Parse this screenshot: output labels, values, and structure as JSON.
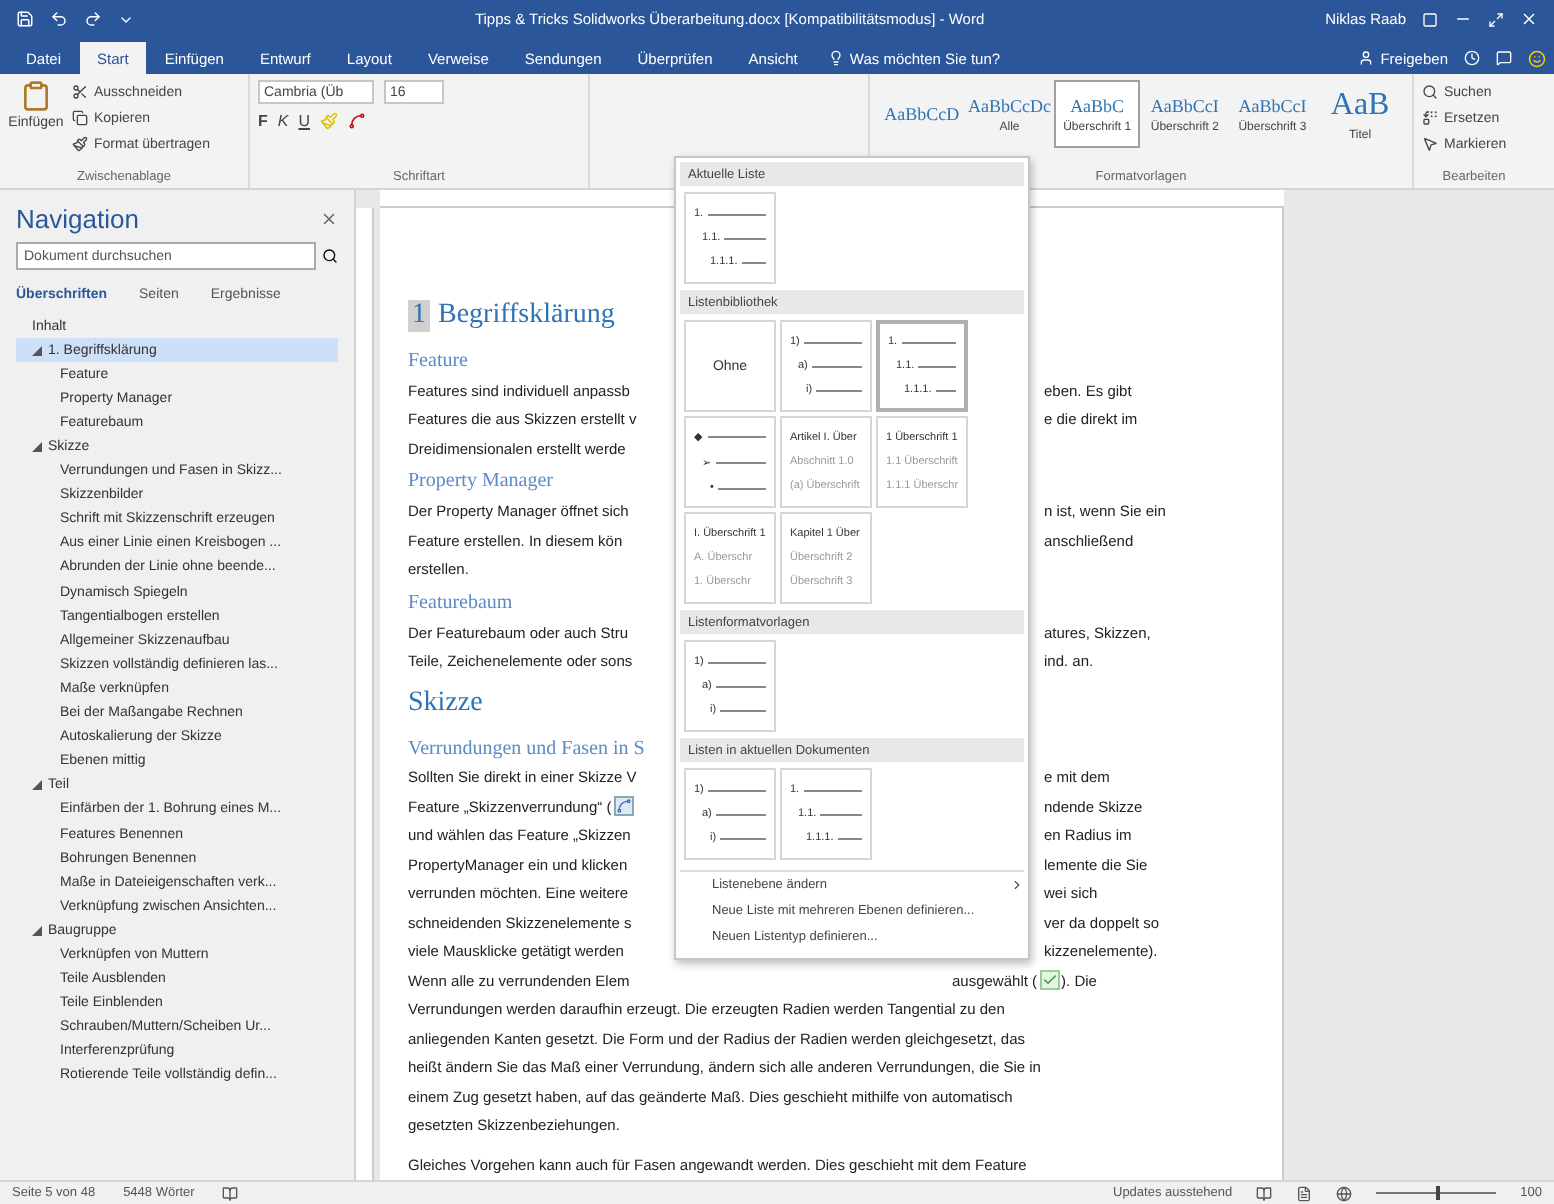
{
  "window": {
    "title": "Tipps & Tricks Solidworks Überarbeitung.docx [Kompatibilitätsmodus] - Word",
    "user": "Niklas Raab"
  },
  "ribbon_tabs": [
    {
      "label": "Datei",
      "selected": false
    },
    {
      "label": "Start",
      "selected": true
    },
    {
      "label": "Einfügen",
      "selected": false
    },
    {
      "label": "Entwurf",
      "selected": false
    },
    {
      "label": "Layout",
      "selected": false
    },
    {
      "label": "Verweise",
      "selected": false
    },
    {
      "label": "Sendungen",
      "selected": false
    },
    {
      "label": "Überprüfen",
      "selected": false
    },
    {
      "label": "Ansicht",
      "selected": false
    }
  ],
  "tell_me": "Was möchten Sie tun?",
  "share": "Freigeben",
  "clipboard": {
    "paste": "Einfügen",
    "cut": "Ausschneiden",
    "copy": "Kopieren",
    "format_painter": "Format übertragen",
    "label": "Zwischenablage"
  },
  "font": {
    "name": "Cambria (Üb",
    "size": "16",
    "label": "Schriftart",
    "format_buttons": [
      {
        "kind": "bold",
        "label": "F"
      },
      {
        "kind": "italic",
        "label": "K"
      },
      {
        "kind": "underline",
        "label": "U"
      }
    ]
  },
  "styles": {
    "items": [
      {
        "sample": "AaBbCcD",
        "selected": false
      },
      {
        "sample": "AaBbCcDc",
        "name": "Alle",
        "selected": false
      },
      {
        "sample": "AaBbC",
        "name": "Überschrift 1",
        "selected": true
      },
      {
        "sample": "AaBbCcI",
        "name": "Überschrift 2",
        "selected": false
      },
      {
        "sample": "AaBbCcI",
        "name": "Überschrift 3",
        "selected": false
      },
      {
        "sample": "AaB",
        "name": "Titel",
        "selected": false
      }
    ],
    "label": "Formatvorlagen"
  },
  "editing": {
    "items": [
      "Suchen",
      "Ersetzen",
      "Markieren"
    ],
    "label": "Bearbeiten"
  },
  "navigation": {
    "title": "Navigation",
    "search": {
      "placeholder": "Dokument durchsuchen"
    },
    "tabs": [
      {
        "label": "Überschriften",
        "selected": true
      },
      {
        "label": "Seiten",
        "selected": false
      },
      {
        "label": "Ergebnisse",
        "selected": false
      }
    ],
    "tree": [
      {
        "label": "Inhalt",
        "selected": false
      },
      {
        "label": "1. Begriffsklärung",
        "selected": true,
        "expanded": true,
        "children": [
          {
            "label": "Feature",
            "selected": false
          },
          {
            "label": "Property Manager",
            "selected": false
          },
          {
            "label": "Featurebaum",
            "selected": false
          }
        ]
      },
      {
        "label": "Skizze",
        "selected": false,
        "expanded": true,
        "children": [
          {
            "label": "Verrundungen und Fasen in Skizz...",
            "selected": false
          },
          {
            "label": "Skizzenbilder",
            "selected": false
          },
          {
            "label": "Schrift mit Skizzenschrift erzeugen",
            "selected": false
          },
          {
            "label": "Aus einer Linie einen Kreisbogen ...",
            "selected": false
          },
          {
            "label": "Abrunden der Linie ohne beende...",
            "selected": false
          },
          {
            "label": "Dynamisch Spiegeln",
            "selected": false
          },
          {
            "label": "Tangentialbogen erstellen",
            "selected": false
          },
          {
            "label": "Allgemeiner Skizzenaufbau",
            "selected": false
          },
          {
            "label": "Skizzen vollständig definieren las...",
            "selected": false
          },
          {
            "label": "Maße verknüpfen",
            "selected": false
          },
          {
            "label": "Bei der Maßangabe Rechnen",
            "selected": false
          },
          {
            "label": "Autoskalierung der Skizze",
            "selected": false
          },
          {
            "label": "Ebenen mittig",
            "selected": false
          }
        ]
      },
      {
        "label": "Teil",
        "selected": false,
        "expanded": true,
        "children": [
          {
            "label": "Einfärben der 1. Bohrung eines M...",
            "selected": false
          },
          {
            "label": "Features Benennen",
            "selected": false
          },
          {
            "label": "Bohrungen Benennen",
            "selected": false
          },
          {
            "label": "Maße in Dateieigenschaften verk...",
            "selected": false
          },
          {
            "label": "Verknüpfung zwischen Ansichten...",
            "selected": false
          }
        ]
      },
      {
        "label": "Baugruppe",
        "selected": false,
        "expanded": true,
        "children": [
          {
            "label": "Verknüpfen von Muttern",
            "selected": false
          },
          {
            "label": "Teile Ausblenden",
            "selected": false
          },
          {
            "label": "Teile Einblenden",
            "selected": false
          },
          {
            "label": "Schrauben/Muttern/Scheiben Ur...",
            "selected": false
          },
          {
            "label": "Interferenzprüfung",
            "selected": false
          },
          {
            "label": "Rotierende Teile vollständig defin...",
            "selected": false
          }
        ]
      }
    ]
  },
  "document": [
    {
      "kind": "h1",
      "num": "1",
      "text": "Begriffsklärung"
    },
    {
      "kind": "h2",
      "text": "Feature"
    },
    {
      "kind": "p",
      "left": "Features sind individuell anpassb",
      "right": "eben. Es gibt"
    },
    {
      "kind": "p",
      "left": "Features die aus Skizzen erstellt v",
      "right": "e die direkt im"
    },
    {
      "kind": "p",
      "left": "Dreidimensionalen erstellt werde"
    },
    {
      "kind": "h2",
      "text": "Property Manager"
    },
    {
      "kind": "p",
      "left": "Der Property Manager öffnet sich",
      "right": "n ist, wenn Sie ein"
    },
    {
      "kind": "p",
      "left": "Feature erstellen. In diesem kön",
      "right": "anschließend"
    },
    {
      "kind": "p",
      "left": "erstellen."
    },
    {
      "kind": "h2",
      "text": "Featurebaum"
    },
    {
      "kind": "p",
      "left": "Der Featurebaum oder auch Stru",
      "right": "atures, Skizzen,"
    },
    {
      "kind": "p",
      "left": "Teile, Zeichenelemente oder sons",
      "right": "ind. an."
    },
    {
      "kind": "h1",
      "text": "Skizze"
    },
    {
      "kind": "h2",
      "left": "Verrundungen und Fasen in S"
    },
    {
      "kind": "p",
      "left": "Sollten Sie direkt in einer Skizze V",
      "right": "e mit dem"
    },
    {
      "kind": "p-icon",
      "left": "Feature „Skizzenverrundung“ (",
      "right": "ndende Skizze"
    },
    {
      "kind": "p",
      "left": "und wählen das Feature „Skizzen",
      "right": "en Radius im"
    },
    {
      "kind": "p",
      "left": "PropertyManager ein und klicken",
      "right": "lemente die Sie"
    },
    {
      "kind": "p",
      "left": "verrunden möchten. Eine weitere",
      "right": "wei sich"
    },
    {
      "kind": "p",
      "left": "schneidenden Skizzenelemente s",
      "right": "ver da doppelt so"
    },
    {
      "kind": "p",
      "left": "viele Mausklicke getätigt werden",
      "right": "kizzenelemente)."
    },
    {
      "kind": "p-check",
      "left": "Wenn alle zu verrundenden Elem",
      "right": "ausgewählt (",
      "after": "). Die"
    },
    {
      "kind": "p",
      "left": "Verrundungen werden daraufhin erzeugt. Die erzeugten Radien werden Tangential zu den"
    },
    {
      "kind": "p",
      "left": "anliegenden Kanten gesetzt. Die Form und der Radius der Radien werden gleichgesetzt, das"
    },
    {
      "kind": "p",
      "left": "heißt ändern Sie das Maß einer Verrundung, ändern sich alle anderen Verrundungen, die Sie in"
    },
    {
      "kind": "p",
      "left": "einem Zug gesetzt haben, auf das geänderte Maß. Dies geschieht mithilfe von automatisch"
    },
    {
      "kind": "p",
      "left": "gesetzten Skizzenbeziehungen."
    },
    {
      "kind": "gap"
    },
    {
      "kind": "p",
      "left": "Gleiches Vorgehen kann auch für Fasen angewandt werden. Dies geschieht mit dem Feature"
    }
  ],
  "list_menu": {
    "sections": [
      {
        "title": "Aktuelle Liste",
        "tiles": [
          {
            "kind": "levels",
            "selected": false,
            "rows": [
              "1.",
              "1.1.",
              "1.1.1."
            ]
          }
        ]
      },
      {
        "title": "Listenbibliothek",
        "tiles": [
          {
            "kind": "none",
            "label": "Ohne",
            "selected": false
          },
          {
            "kind": "levels",
            "selected": false,
            "rows": [
              "1)",
              "a)",
              "i)"
            ]
          },
          {
            "kind": "levels",
            "selected": true,
            "rows": [
              "1.",
              "1.1.",
              "1.1.1."
            ]
          },
          {
            "kind": "levels",
            "selected": false,
            "rows": [
              "◆",
              "➢",
              "•"
            ]
          },
          {
            "kind": "headings",
            "selected": false,
            "rows": [
              "Artikel I. Über",
              "Abschnitt 1.0",
              "(a) Überschrift"
            ]
          },
          {
            "kind": "headings",
            "selected": false,
            "rows": [
              "1 Überschrift 1",
              "1.1 Überschrift",
              "1.1.1 Überschr"
            ]
          },
          {
            "kind": "headings",
            "selected": false,
            "rows": [
              "I. Überschrift 1",
              "A. Überschr",
              "1. Überschr"
            ]
          },
          {
            "kind": "headings",
            "selected": false,
            "rows": [
              "Kapitel 1 Über",
              "Überschrift 2",
              "Überschrift 3"
            ]
          }
        ]
      },
      {
        "title": "Listenformatvorlagen",
        "tiles": [
          {
            "kind": "levels",
            "selected": false,
            "rows": [
              "1)",
              "a)",
              "i)"
            ]
          }
        ]
      },
      {
        "title": "Listen in aktuellen Dokumenten",
        "tiles": [
          {
            "kind": "levels",
            "selected": false,
            "rows": [
              "1)",
              "a)",
              "i)"
            ]
          },
          {
            "kind": "levels",
            "selected": false,
            "rows": [
              "1.",
              "1.1.",
              "1.1.1."
            ]
          }
        ]
      }
    ],
    "commands": [
      {
        "label": "Listenebene ändern",
        "submenu": true
      },
      {
        "label": "Neue Liste mit mehreren Ebenen definieren...",
        "submenu": false
      },
      {
        "label": "Neuen Listentyp definieren...",
        "submenu": false
      }
    ]
  },
  "status_bar": {
    "page": "Seite 5 von 48",
    "words": "5448 Wörter",
    "updates": "Updates ausstehend",
    "zoom": "100",
    "zoom_slider": {
      "level": 0.5
    }
  }
}
